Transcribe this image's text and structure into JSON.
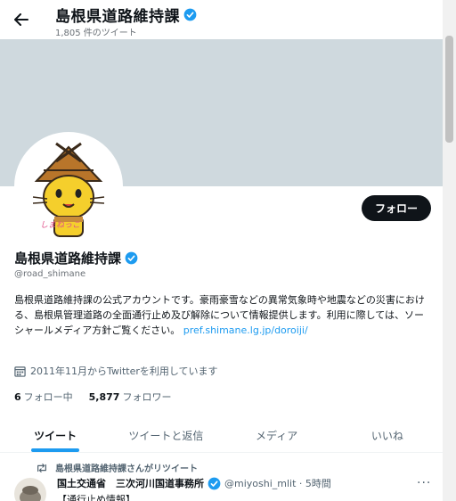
{
  "header": {
    "title": "島根県道路維持課",
    "tweet_count": "1,805 件のツイート"
  },
  "profile": {
    "display_name": "島根県道路維持課",
    "handle": "@road_shimane",
    "follow_label": "フォロー",
    "bio_text": "島根県道路維持課の公式アカウントです。豪雨豪雪などの異常気象時や地震などの災害における、島根県管理道路の全面通行止め及び解除について情報提供します。利用に際しては、ソーシャールメディア方針ご覧ください。",
    "bio_link": "pref.shimane.lg.jp/doroiji/",
    "joined": "2011年11月からTwitterを利用しています",
    "following_count": "6",
    "following_label": "フォロー中",
    "followers_count": "5,877",
    "followers_label": "フォロワー",
    "avatar_caption": "しまねっこ"
  },
  "tabs": [
    {
      "label": "ツイート",
      "active": true
    },
    {
      "label": "ツイートと返信",
      "active": false
    },
    {
      "label": "メディア",
      "active": false
    },
    {
      "label": "いいね",
      "active": false
    }
  ],
  "timeline": {
    "retweet_notice": "島根県道路維持課さんがリツイート",
    "tweet": {
      "author": "国土交通省　三次河川国道事務所",
      "handle_time": "@miyoshi_mlit · 5時間",
      "text": "【通行止め情報】",
      "more": "···"
    }
  },
  "colors": {
    "accent": "#1d9bf0",
    "banner": "#cfd9de",
    "text": "#0f1419",
    "muted": "#536471"
  },
  "icons": [
    "back-arrow-icon",
    "verified-badge-icon",
    "calendar-icon",
    "retweet-icon",
    "more-icon"
  ]
}
